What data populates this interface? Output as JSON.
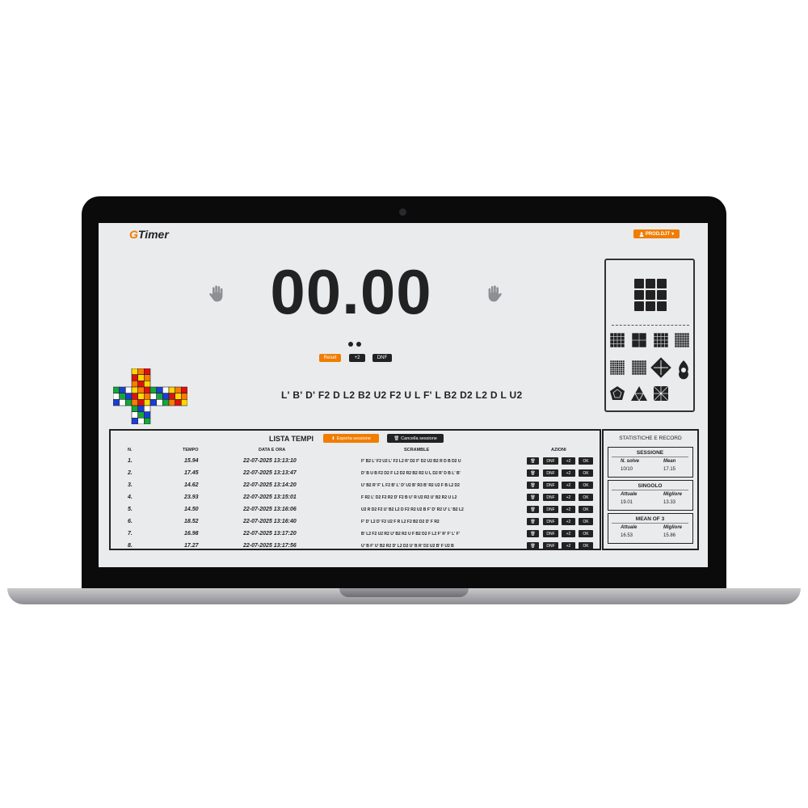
{
  "app": {
    "logo_g": "G",
    "logo_rest": "Timer",
    "user_label": "PROD.DJT",
    "user_icon": "user-icon",
    "accent": "#f07d00"
  },
  "timer": {
    "display": "00.00",
    "reset_label": "Reset",
    "plus2_label": "+2",
    "dnf_label": "DNF"
  },
  "scramble": "L' B' D' F2 D L2 B2 U2 F2 U L F' L B2 D2 L2 D L U2",
  "times": {
    "title": "LISTA TEMPI",
    "export_label": "Esporta sessione",
    "clear_label": "Cancella sessione",
    "headers": {
      "n": "N.",
      "time": "TEMPO",
      "date": "DATA E ORA",
      "scramble": "SCRAMBLE",
      "actions": "AZIONI"
    },
    "action_labels": {
      "dnf": "DNF",
      "plus2": "+2",
      "ok": "OK"
    },
    "rows": [
      {
        "n": "1.",
        "time": "15.94",
        "date": "22-07-2025 13:13:10",
        "scramble": "F' B2 L' F2 U2 L' F2 L2 R' D2 F' D2 U2 B2 R D B D2 U"
      },
      {
        "n": "2.",
        "time": "17.45",
        "date": "22-07-2025 13:13:47",
        "scramble": "D' B U B F2 D2 F L2 D2 R2 B2 R2 U L D2 R' D B L' B'"
      },
      {
        "n": "3.",
        "time": "14.62",
        "date": "22-07-2025 13:14:20",
        "scramble": "U' B2 R' F' L F2 B' L' D' U2 B' R3 B' R2 U2 F B L2 D2"
      },
      {
        "n": "4.",
        "time": "23.93",
        "date": "22-07-2025 13:15:01",
        "scramble": "F R2 L' D2 F2 R2 D' F2 B U' R U2 R2 U' B2 R2 U L2"
      },
      {
        "n": "5.",
        "time": "14.50",
        "date": "22-07-2025 13:16:06",
        "scramble": "U2 R D2 F2 U' B2 L2 D F2 R2 U2 B F' D' R2 U' L' B2 L2"
      },
      {
        "n": "6.",
        "time": "18.52",
        "date": "22-07-2025 13:16:40",
        "scramble": "F' D' L2 D' F2 U2 F R L2 F2 B2 D2 D' F R2"
      },
      {
        "n": "7.",
        "time": "16.98",
        "date": "22-07-2025 13:17:20",
        "scramble": "B' L2 F2 U2 R2 U' B2 R2 U F B2 D2 F L2 F' R' F' L' F'"
      },
      {
        "n": "8.",
        "time": "17.27",
        "date": "22-07-2025 13:17:56",
        "scramble": "U' B F' U' B2 R2 D' L2 D2 U' B R' D2 U2 B' F U2 B"
      }
    ]
  },
  "stats": {
    "title": "STATISTICHE E RECORD",
    "sessione": {
      "title": "SESSIONE",
      "k1": "N. solve",
      "v1": "10/10",
      "k2": "Mean",
      "v2": "17.15"
    },
    "singolo": {
      "title": "SINGOLO",
      "k1": "Attuale",
      "v1": "19.01",
      "k2": "Migliore",
      "v2": "13.33"
    },
    "mean3": {
      "title": "MEAN OF 3",
      "k1": "Attuale",
      "v1": "16.53",
      "k2": "Migliore",
      "v2": "15.86"
    }
  },
  "icons": {
    "hand_left": "hand-icon",
    "hand_right": "hand-icon",
    "delete": "trash-icon",
    "download": "download-icon"
  },
  "puzzles": [
    "3x3",
    "2x2",
    "4x4",
    "5x5",
    "6x6",
    "7x7",
    "square-1",
    "clock",
    "megaminx",
    "pyraminx",
    "skewb"
  ]
}
